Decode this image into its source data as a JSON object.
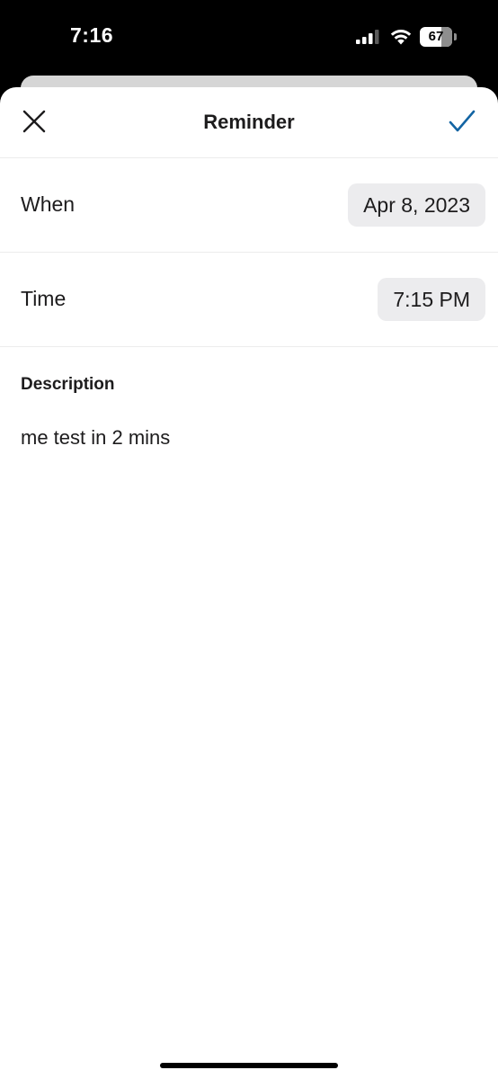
{
  "status_bar": {
    "time": "7:16",
    "battery_level": "67",
    "battery_fraction": 0.67,
    "signal_icon": "cellular-signal-icon",
    "wifi_icon": "wifi-icon",
    "battery_icon": "battery-icon"
  },
  "header": {
    "title": "Reminder",
    "close_icon": "close-icon",
    "done_icon": "checkmark-icon"
  },
  "form": {
    "when": {
      "label": "When",
      "value": "Apr 8, 2023"
    },
    "time": {
      "label": "Time",
      "value": "7:15 PM"
    },
    "description": {
      "label": "Description",
      "value": "me test in 2 mins"
    }
  },
  "colors": {
    "accent": "#1264a3",
    "text": "#1d1c1d",
    "pill_background": "#ececee",
    "divider": "#ececec"
  }
}
